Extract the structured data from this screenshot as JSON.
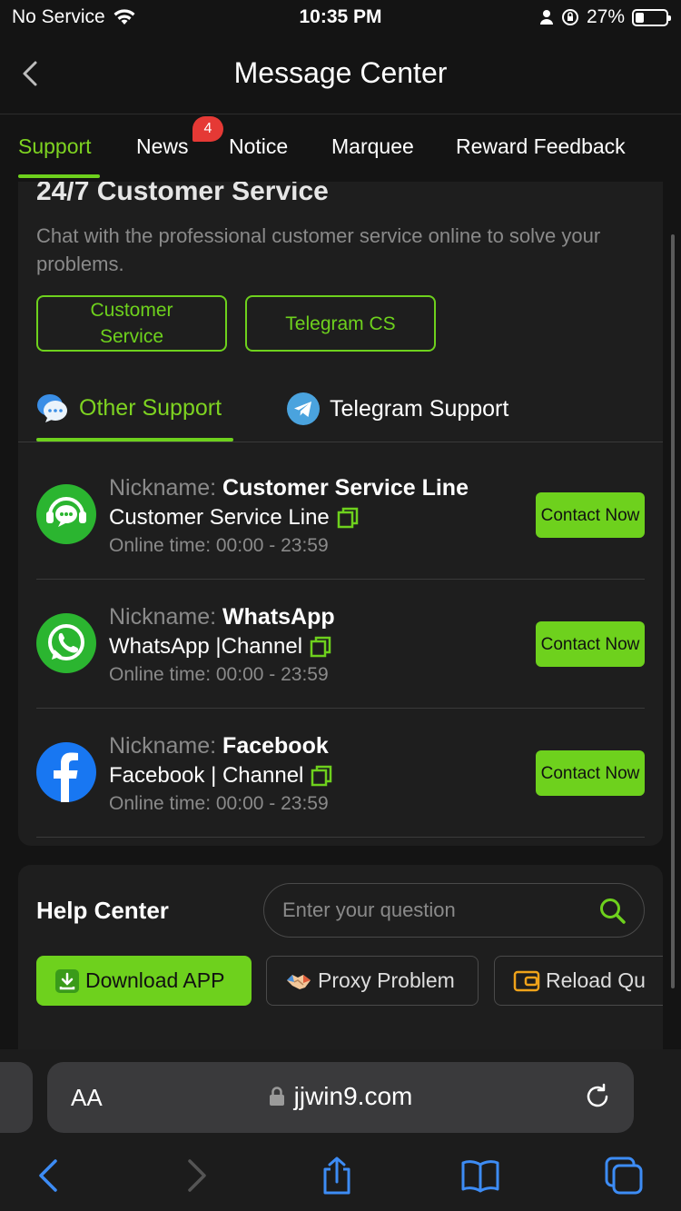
{
  "status_bar": {
    "carrier": "No Service",
    "time": "10:35 PM",
    "battery_percent_label": "27%",
    "battery_level": 0.27
  },
  "header": {
    "title": "Message Center"
  },
  "tabs": [
    {
      "label": "Support",
      "active": true
    },
    {
      "label": "News",
      "badge": "4"
    },
    {
      "label": "Notice"
    },
    {
      "label": "Marquee"
    },
    {
      "label": "Reward Feedback"
    }
  ],
  "service": {
    "title": "24/7 Customer Service",
    "description": "Chat with the professional customer service online to solve your problems.",
    "buttons": [
      "Customer Service",
      "Telegram CS"
    ]
  },
  "sub_tabs": [
    {
      "label": "Other Support",
      "active": true
    },
    {
      "label": "Telegram Support"
    }
  ],
  "contacts": [
    {
      "nickname_prefix": "Nickname:",
      "nickname": "Customer Service Line",
      "channel": "Customer Service Line",
      "online_time": "Online time: 00:00 - 23:59",
      "button": "Contact Now",
      "icon": "headset-chat-icon"
    },
    {
      "nickname_prefix": "Nickname:",
      "nickname": "WhatsApp",
      "channel": "WhatsApp |Channel",
      "online_time": "Online time: 00:00 - 23:59",
      "button": "Contact Now",
      "icon": "whatsapp-icon"
    },
    {
      "nickname_prefix": "Nickname:",
      "nickname": "Facebook",
      "channel": "Facebook | Channel",
      "online_time": "Online time: 00:00 - 23:59",
      "button": "Contact Now",
      "icon": "facebook-icon"
    }
  ],
  "help_center": {
    "title": "Help Center",
    "search_placeholder": "Enter your question",
    "chips": [
      "Download APP",
      "Proxy Problem",
      "Reload Qu"
    ]
  },
  "browser": {
    "aa_label": "AA",
    "url": "jjwin9.com"
  },
  "colors": {
    "accent": "#6ed11d",
    "background": "#141414",
    "card": "#1e1e1e",
    "badge": "#e53935"
  }
}
